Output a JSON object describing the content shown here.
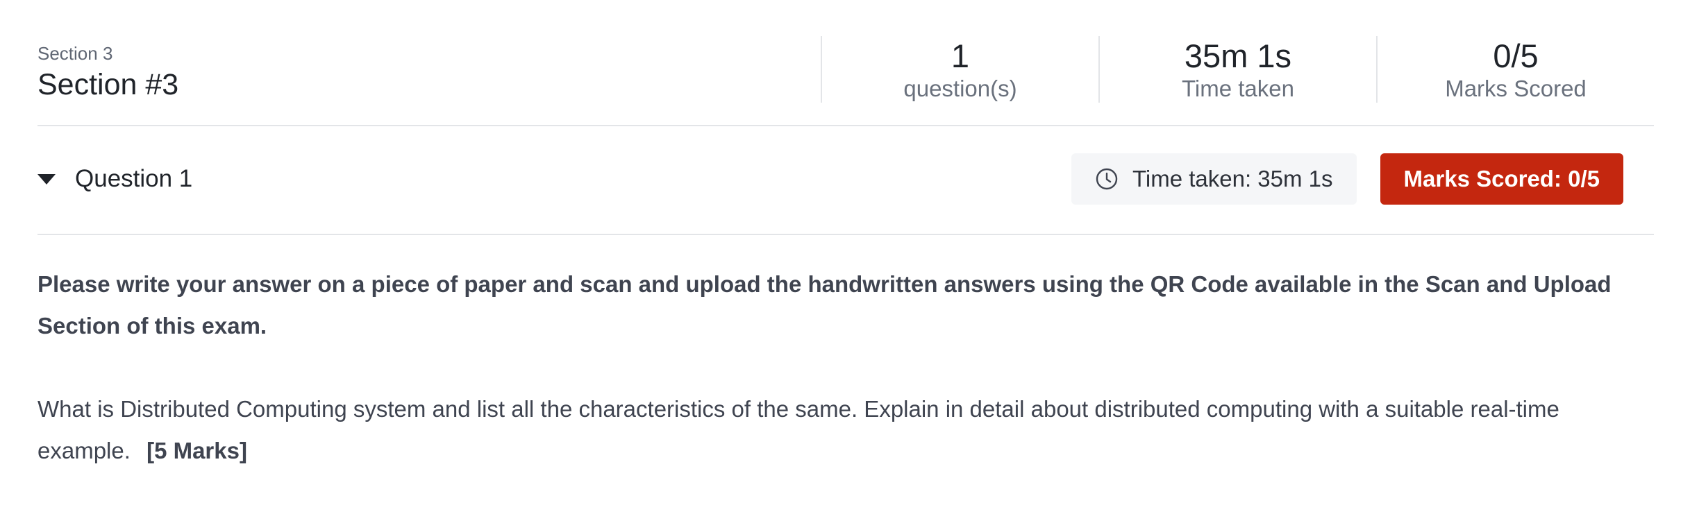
{
  "section": {
    "subtitle": "Section 3",
    "title": "Section #3"
  },
  "stats": [
    {
      "value": "1",
      "label": "question(s)"
    },
    {
      "value": "35m 1s",
      "label": "Time taken"
    },
    {
      "value": "0/5",
      "label": "Marks Scored"
    }
  ],
  "question": {
    "title": "Question 1",
    "time_taken_label": "Time taken: 35m 1s",
    "marks_label": "Marks Scored: 0/5",
    "instructions": "Please write your answer on a piece of paper and scan and upload the handwritten answers using the QR Code available in the Scan and Upload Section of this exam.",
    "text": "What is Distributed Computing system and list all the characteristics of the same. Explain in detail about distributed computing with a suitable real-time example.",
    "marks_tag": "[5 Marks]"
  },
  "colors": {
    "marks_button_bg": "#c4270f",
    "chip_bg": "#f5f6f8",
    "divider": "#e3e5e8"
  },
  "icons": {
    "expand": "caret-down-icon",
    "time": "clock-icon"
  }
}
